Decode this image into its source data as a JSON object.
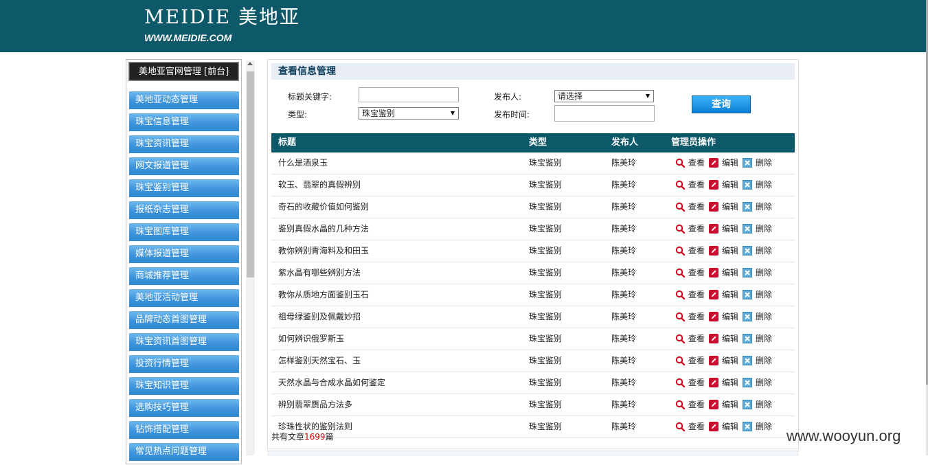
{
  "header": {
    "logo_mark": "MEIDIE 美地亚",
    "logo_url": "WWW.MEIDIE.COM",
    "bg_color": "#0d5869"
  },
  "sidebar": {
    "title": "美地亚官网管理 [前台]",
    "items": [
      "美地亚动态管理",
      "珠宝信息管理",
      "珠宝资讯管理",
      "网文报道管理",
      "珠宝鉴别管理",
      "报纸杂志管理",
      "珠宝图库管理",
      "媒体报道管理",
      "商城推荐管理",
      "美地亚活动管理",
      "品牌动态首图管理",
      "珠宝资讯首图管理",
      "投资行情管理",
      "珠宝知识管理",
      "选购技巧管理",
      "钻饰搭配管理",
      "常见热点问题管理"
    ]
  },
  "panel": {
    "title": "查看信息管理",
    "search": {
      "keyword_label": "标题关键字:",
      "keyword_value": "",
      "publisher_label": "发布人:",
      "publisher_value": "请选择",
      "type_label": "类型:",
      "type_value": "珠宝鉴别",
      "time_label": "发布时间:",
      "time_value": "",
      "query_button": "查询"
    },
    "table": {
      "headers": [
        "标题",
        "类型",
        "发布人",
        "管理员操作"
      ],
      "ops": {
        "view": "查看",
        "edit": "编辑",
        "delete": "删除"
      },
      "rows": [
        {
          "title": "什么是酒泉玉",
          "type": "珠宝鉴别",
          "publisher": "陈美玲"
        },
        {
          "title": "软玉、翡翠的真假辨别",
          "type": "珠宝鉴别",
          "publisher": "陈美玲"
        },
        {
          "title": "奇石的收藏价值如何鉴别",
          "type": "珠宝鉴别",
          "publisher": "陈美玲"
        },
        {
          "title": "鉴别真假水晶的几种方法",
          "type": "珠宝鉴别",
          "publisher": "陈美玲"
        },
        {
          "title": "教你辨别青海料及和田玉",
          "type": "珠宝鉴别",
          "publisher": "陈美玲"
        },
        {
          "title": "紫水晶有哪些辨别方法",
          "type": "珠宝鉴别",
          "publisher": "陈美玲"
        },
        {
          "title": "教你从质地方面鉴别玉石",
          "type": "珠宝鉴别",
          "publisher": "陈美玲"
        },
        {
          "title": "祖母绿鉴别及佩戴妙招",
          "type": "珠宝鉴别",
          "publisher": "陈美玲"
        },
        {
          "title": "如何辨识俄罗斯玉",
          "type": "珠宝鉴别",
          "publisher": "陈美玲"
        },
        {
          "title": "怎样鉴别天然宝石、玉",
          "type": "珠宝鉴别",
          "publisher": "陈美玲"
        },
        {
          "title": "天然水晶与合成水晶如何鉴定",
          "type": "珠宝鉴别",
          "publisher": "陈美玲"
        },
        {
          "title": "辨别翡翠赝品方法多",
          "type": "珠宝鉴别",
          "publisher": "陈美玲"
        },
        {
          "title": "珍珠性状的鉴别法则",
          "type": "珠宝鉴别",
          "publisher": "陈美玲"
        }
      ]
    },
    "summary": {
      "prefix": "共有文章",
      "count": "1699",
      "suffix": "篇"
    }
  },
  "watermark": "www.wooyun.org"
}
